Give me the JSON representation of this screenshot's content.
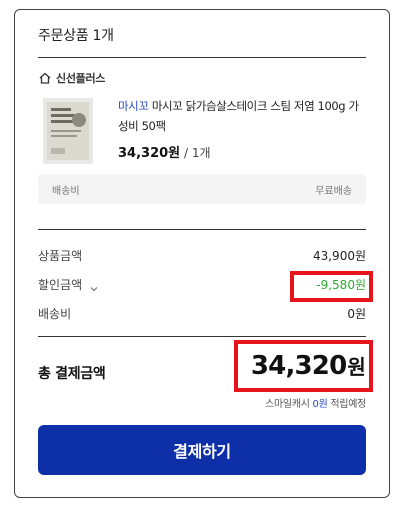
{
  "order": {
    "title": "주문상품 1개"
  },
  "seller": {
    "name": "신선플러스"
  },
  "product": {
    "brand": "마시꼬",
    "name": "마시꼬 닭가슴살스테이크 스팀 저염 100g 가성비 50팩",
    "price": "34,320원",
    "quantity": "/ 1개"
  },
  "shipping": {
    "label": "배송비",
    "value": "무료배송"
  },
  "summary": {
    "product_amount_label": "상품금액",
    "product_amount": "43,900원",
    "discount_label": "할인금액",
    "discount": "-9,580원",
    "delivery_label": "배송비",
    "delivery": "0원"
  },
  "total": {
    "label": "총 결제금액",
    "value": "34,320",
    "unit": "원",
    "cash_prefix": "스마일캐시",
    "cash_points": "0원",
    "cash_suffix": "적립예정"
  },
  "pay_button": "결제하기",
  "colors": {
    "accent": "#0d2fa8",
    "discount": "#2fa831",
    "highlight": "#e8141b"
  }
}
